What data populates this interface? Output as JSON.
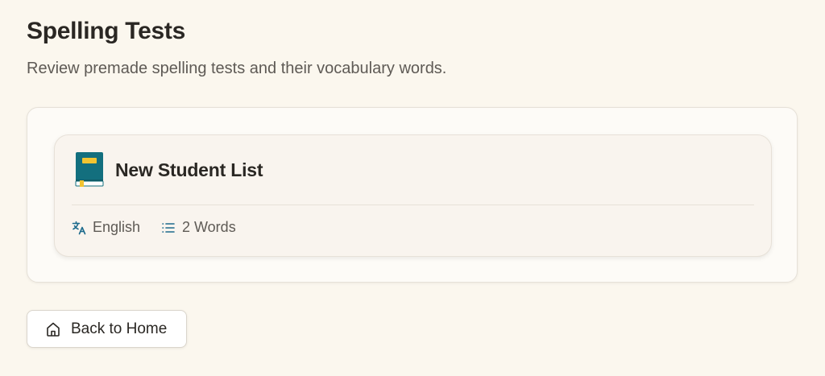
{
  "header": {
    "title": "Spelling Tests",
    "subtitle": "Review premade spelling tests and their vocabulary words."
  },
  "tests": [
    {
      "title": "New Student List",
      "icon": "book-icon",
      "language": "English",
      "language_icon": "translate-icon",
      "word_count": "2 Words",
      "word_count_icon": "list-icon"
    }
  ],
  "footer": {
    "back_label": "Back to Home",
    "back_icon": "home-icon"
  },
  "colors": {
    "background": "#FBF7EE",
    "accent": "#1D6A8C",
    "book_cover": "#136F7E",
    "book_label": "#F2C431"
  }
}
